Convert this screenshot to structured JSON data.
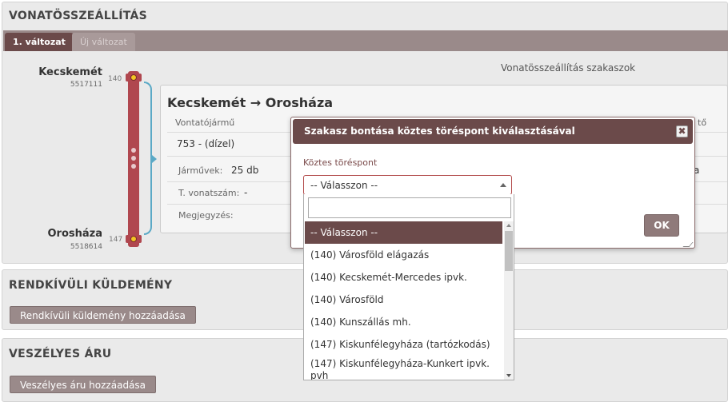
{
  "panel_title": "VONATÖSSZEÁLLÍTÁS",
  "tabs": [
    {
      "label": "1. változat",
      "active": true
    },
    {
      "label": "Új változat",
      "active": false
    }
  ],
  "route": {
    "from": {
      "name": "Kecskemét",
      "code": "5517111",
      "km": "140"
    },
    "to": {
      "name": "Orosháza",
      "code": "5518614",
      "km": "147"
    }
  },
  "sections_heading": "Vonatösszeállítás szakaszok",
  "section": {
    "title": "Kecskemét → Orosháza",
    "locomotive_label": "Vontatójármű",
    "locomotive_value": "753 - (dízel)",
    "vehicles_label": "Járművek:",
    "vehicles_value": "25 db",
    "train_number_label": "T. vonatszám:",
    "train_number_value": "-",
    "note_label": "Megjegyzés:",
    "partial_right_1": "tő",
    "partial_right_2": "a"
  },
  "extraordinary": {
    "title": "RENDKÍVÜLI KÜLDEMÉNY",
    "button": "Rendkívüli küldemény hozzáadása"
  },
  "dangerous": {
    "title": "VESZÉLYES ÁRU",
    "button": "Veszélyes áru hozzáadása"
  },
  "modal": {
    "title": "Szakasz bontása köztes töréspont kiválasztásával",
    "close_symbol": "✖",
    "field_label": "Köztes töréspont",
    "selected_value": "-- Válasszon --",
    "search_value": "",
    "ok_label": "OK",
    "options": [
      "-- Válasszon --",
      "(140) Városföld elágazás",
      "(140) Kecskemét-Mercedes ipvk.",
      "(140) Városföld",
      "(140) Kunszállás mh.",
      "(147) Kiskunfélegyháza (tartózkodás)",
      "(147) Kiskunfélegyháza-Kunkert ipvk. pvh"
    ]
  },
  "colors": {
    "brand_dark": "#6b4a4a",
    "track": "#b0474f",
    "bracket": "#5aa9c6",
    "station_dot": "#f3c624",
    "select_border": "#b24a4a"
  }
}
